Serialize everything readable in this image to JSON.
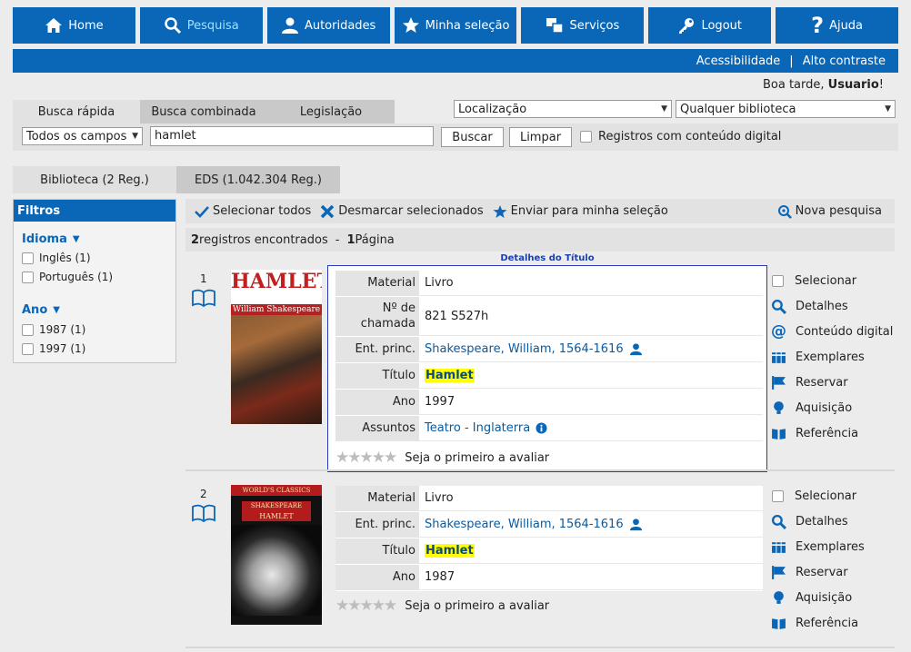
{
  "nav": [
    {
      "label": "Home",
      "icon": "home-icon"
    },
    {
      "label": "Pesquisa",
      "icon": "search-icon"
    },
    {
      "label": "Autoridades",
      "icon": "user-icon"
    },
    {
      "label": "Minha seleção",
      "icon": "star-icon"
    },
    {
      "label": "Serviços",
      "icon": "windows-icon"
    },
    {
      "label": "Logout",
      "icon": "key-icon"
    },
    {
      "label": "Ajuda",
      "icon": "question-icon"
    }
  ],
  "topbar": {
    "accessibility": "Acessibilidade",
    "separator": "|",
    "contrast": "Alto contraste"
  },
  "greeting": {
    "text": "Boa tarde, ",
    "user": "Usuario",
    "suffix": "!"
  },
  "search_tabs": [
    "Busca rápida",
    "Busca combinada",
    "Legislação"
  ],
  "location_select": "Localização",
  "library_select": "Qualquer biblioteca",
  "field_select": "Todos os campos",
  "search_value": "hamlet",
  "buttons": {
    "search": "Buscar",
    "clear": "Limpar"
  },
  "digital_only": "Registros com conteúdo digital",
  "result_tabs": [
    "Biblioteca (2 Reg.)",
    "EDS (1.042.304 Reg.)"
  ],
  "filters": {
    "title": "Filtros",
    "groups": [
      {
        "name": "Idioma",
        "items": [
          "Inglês (1)",
          "Português (1)"
        ]
      },
      {
        "name": "Ano",
        "items": [
          "1987 (1)",
          "1997 (1)"
        ]
      }
    ]
  },
  "actions": {
    "select_all": "Selecionar todos",
    "deselect": "Desmarcar selecionados",
    "send": "Enviar para minha seleção",
    "new_search": "Nova pesquisa"
  },
  "found": {
    "count": "2",
    "text": " registros encontrados",
    "dash": "-",
    "pages": "1",
    "pages_text": " Página"
  },
  "details_label": "Detalhes do Título",
  "records": [
    {
      "num": "1",
      "cover": {
        "title": "HAMLET",
        "author": "William Shakespeare"
      },
      "fields": [
        {
          "label": "Material",
          "value": "Livro"
        },
        {
          "label": "Nº de chamada",
          "value": "821 S527h"
        },
        {
          "label": "Ent. princ.",
          "value": "Shakespeare, William, 1564-1616"
        },
        {
          "label": "Título",
          "value": "Hamlet"
        },
        {
          "label": "Ano",
          "value": "1997"
        },
        {
          "label": "Assuntos",
          "value": "Teatro - Inglaterra"
        }
      ],
      "rating_text": "Seja o primeiro a avaliar",
      "side": [
        {
          "label": "Selecionar",
          "icon": "checkbox-icon"
        },
        {
          "label": "Detalhes",
          "icon": "magnifier-icon"
        },
        {
          "label": "Conteúdo digital",
          "icon": "at-icon"
        },
        {
          "label": "Exemplares",
          "icon": "copies-icon"
        },
        {
          "label": "Reservar",
          "icon": "flag-icon"
        },
        {
          "label": "Aquisição",
          "icon": "lightbulb-icon"
        },
        {
          "label": "Referência",
          "icon": "open-book-icon"
        }
      ]
    },
    {
      "num": "2",
      "cover": {
        "top": "WORLD'S CLASSICS",
        "author": "SHAKESPEARE",
        "title": "HAMLET"
      },
      "fields": [
        {
          "label": "Material",
          "value": "Livro"
        },
        {
          "label": "Ent. princ.",
          "value": "Shakespeare, William, 1564-1616"
        },
        {
          "label": "Título",
          "value": "Hamlet"
        },
        {
          "label": "Ano",
          "value": "1987"
        }
      ],
      "rating_text": "Seja o primeiro a avaliar",
      "side": [
        {
          "label": "Selecionar",
          "icon": "checkbox-icon"
        },
        {
          "label": "Detalhes",
          "icon": "magnifier-icon"
        },
        {
          "label": "Exemplares",
          "icon": "copies-icon"
        },
        {
          "label": "Reservar",
          "icon": "flag-icon"
        },
        {
          "label": "Aquisição",
          "icon": "lightbulb-icon"
        },
        {
          "label": "Referência",
          "icon": "open-book-icon"
        }
      ]
    }
  ],
  "colors": {
    "primary": "#0a66b7",
    "highlight": "#ffff00",
    "details_border": "#2a38b8"
  }
}
